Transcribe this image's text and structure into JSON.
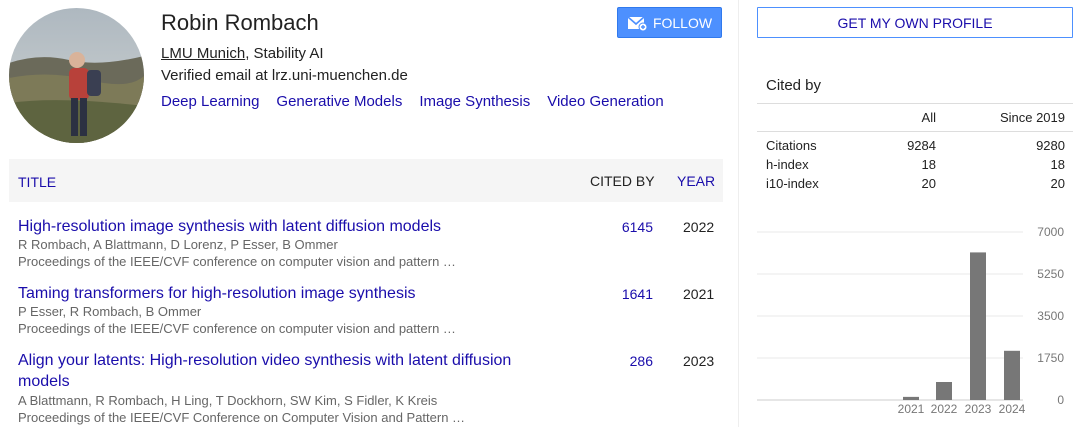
{
  "profile": {
    "name": "Robin Rombach",
    "affiliation_link": "LMU Munich",
    "affiliation_rest": ", Stability AI",
    "email": "Verified email at lrz.uni-muenchen.de",
    "interests": [
      "Deep Learning",
      "Generative Models",
      "Image Synthesis",
      "Video Generation"
    ]
  },
  "buttons": {
    "follow": "FOLLOW",
    "own_profile": "GET MY OWN PROFILE"
  },
  "table": {
    "headers": {
      "title": "TITLE",
      "cited_by": "CITED BY",
      "year": "YEAR"
    },
    "rows": [
      {
        "title": "High-resolution image synthesis with latent diffusion models",
        "authors": "R Rombach, A Blattmann, D Lorenz, P Esser, B Ommer",
        "venue": "Proceedings of the IEEE/CVF conference on computer vision and pattern …",
        "cited_by": "6145",
        "year": "2022"
      },
      {
        "title": "Taming transformers for high-resolution image synthesis",
        "authors": "P Esser, R Rombach, B Ommer",
        "venue": "Proceedings of the IEEE/CVF conference on computer vision and pattern …",
        "cited_by": "1641",
        "year": "2021"
      },
      {
        "title": "Align your latents: High-resolution video synthesis with latent diffusion models",
        "authors": "A Blattmann, R Rombach, H Ling, T Dockhorn, SW Kim, S Fidler, K Kreis",
        "venue": "Proceedings of the IEEE/CVF Conference on Computer Vision and Pattern …",
        "cited_by": "286",
        "year": "2023"
      }
    ]
  },
  "cited_by": {
    "title": "Cited by",
    "col_all": "All",
    "col_since": "Since 2019",
    "metrics": [
      {
        "label": "Citations",
        "all": "9284",
        "since": "9280"
      },
      {
        "label": "h-index",
        "all": "18",
        "since": "18"
      },
      {
        "label": "i10-index",
        "all": "20",
        "since": "20"
      }
    ]
  },
  "chart_data": {
    "type": "bar",
    "categories": [
      "2021",
      "2022",
      "2023",
      "2024"
    ],
    "values": [
      130,
      750,
      6150,
      2050
    ],
    "ylim": [
      0,
      7000
    ],
    "yticks": [
      "7000",
      "5250",
      "3500",
      "1750",
      "0"
    ],
    "grid": true,
    "bar_color": "#777777"
  },
  "colors": {
    "link": "#1a0dab",
    "button_blue": "#4d90fe"
  }
}
